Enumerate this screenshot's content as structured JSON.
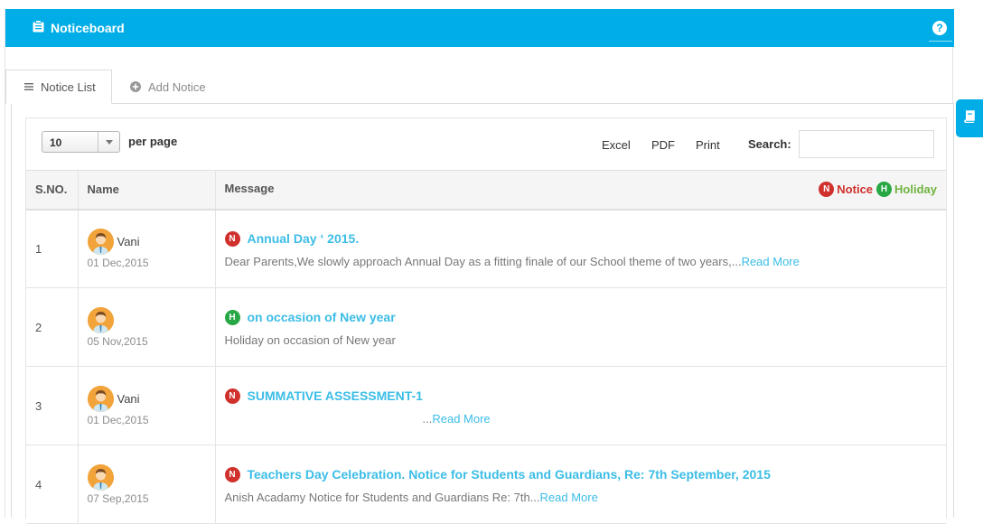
{
  "header": {
    "title": "Noticeboard",
    "help_symbol": "?"
  },
  "tabs": [
    {
      "label": "Notice List",
      "active": true
    },
    {
      "label": "Add Notice",
      "active": false
    }
  ],
  "toolbar": {
    "page_size": "10",
    "per_page_label": "per page",
    "buttons": [
      "Excel",
      "PDF",
      "Print"
    ],
    "search_label": "Search:",
    "search_value": ""
  },
  "table": {
    "headers": {
      "sno": "S.NO.",
      "name": "Name",
      "message": "Message"
    },
    "legend": {
      "notice_badge": "N",
      "notice_label": "Notice",
      "holiday_badge": "H",
      "holiday_label": "Holiday"
    },
    "rows": [
      {
        "sno": "1",
        "name": "Vani",
        "date": "01 Dec,2015",
        "type_badge": "N",
        "type": "notice",
        "title": "Annual Day ‘ 2015.",
        "body": "Dear Parents,We slowly approach Annual Day as a fitting finale of our School theme of two years,...",
        "read_more": "Read More"
      },
      {
        "sno": "2",
        "name": "",
        "date": "05 Nov,2015",
        "type_badge": "H",
        "type": "holiday",
        "title": "on occasion of New year",
        "body": "Holiday on occasion of New year",
        "read_more": ""
      },
      {
        "sno": "3",
        "name": "Vani",
        "date": "01 Dec,2015",
        "type_badge": "N",
        "type": "notice",
        "title": "SUMMATIVE ASSESSMENT-1",
        "body": "...",
        "read_more": "Read More"
      },
      {
        "sno": "4",
        "name": "",
        "date": "07 Sep,2015",
        "type_badge": "N",
        "type": "notice",
        "title": "Teachers Day Celebration. Notice for Students and Guardians, Re: 7th September, 2015",
        "body": "Anish Acadamy Notice for Students and Guardians Re: 7th...",
        "read_more": "Read More"
      }
    ]
  },
  "colors": {
    "brand": "#00ade6",
    "link": "#3bbde6",
    "notice": "#d0312d",
    "holiday": "#27a844"
  }
}
